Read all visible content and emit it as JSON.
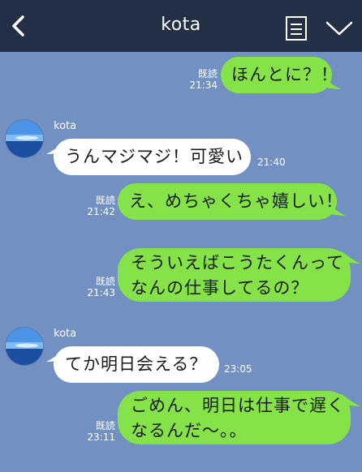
{
  "header": {
    "title": "kota",
    "icons": [
      "chevron-left-icon",
      "note-icon",
      "chevron-down-icon"
    ]
  },
  "colors": {
    "background": "#7290c1",
    "header": "#232f45",
    "sent_bubble": "#85e249",
    "received_bubble": "#ffffff"
  },
  "messages": [
    {
      "direction": "sent",
      "lines": [
        "ほんとに？！"
      ],
      "read": "既読",
      "time": "21:34"
    },
    {
      "direction": "received",
      "sender": "kota",
      "lines": [
        "うんマジマジ！可愛い"
      ],
      "time": "21:40"
    },
    {
      "direction": "sent",
      "lines": [
        "え、めちゃくちゃ嬉しい！"
      ],
      "read": "既読",
      "time": "21:42"
    },
    {
      "direction": "sent",
      "lines": [
        "そういえばこうたくんって",
        "なんの仕事してるの？"
      ],
      "read": "既読",
      "time": "21:43"
    },
    {
      "direction": "received",
      "sender": "kota",
      "lines": [
        "てか明日会える？"
      ],
      "time": "23:05"
    },
    {
      "direction": "sent",
      "lines": [
        "ごめん、明日は仕事で遅く",
        "なるんだ〜。。"
      ],
      "read": "既読",
      "time": "23:11"
    }
  ]
}
